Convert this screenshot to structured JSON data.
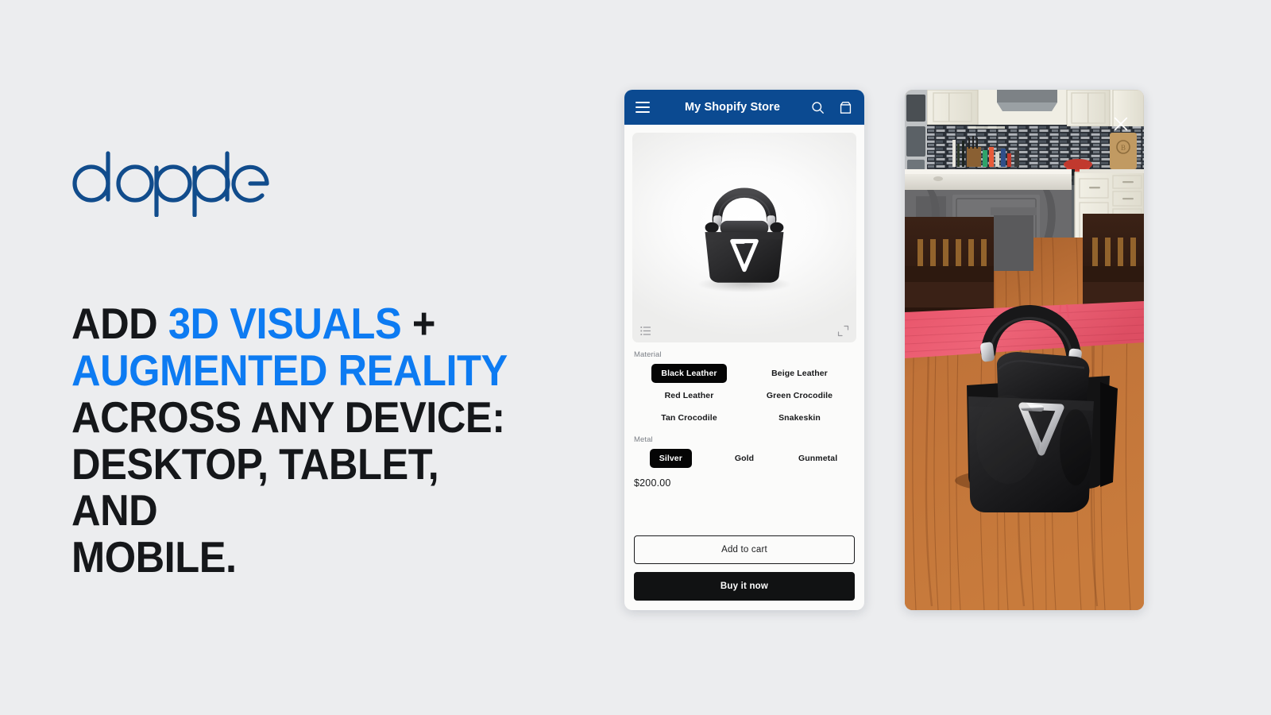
{
  "page": {
    "background_color": "#ECEDEF"
  },
  "brand": {
    "name": "dopple",
    "logo_color": "#114C8C"
  },
  "headline": {
    "line1_plain": "ADD ",
    "line1_accent": "3D VISUALS",
    "line1_tail": " +",
    "line2_accent": "AUGMENTED REALITY",
    "line3": "ACROSS ANY DEVICE:",
    "line4": "DESKTOP, TABLET, AND",
    "line5": "MOBILE.",
    "accent_color": "#0D7BF2",
    "text_color": "#15171A"
  },
  "phone": {
    "header": {
      "title": "My Shopify Store",
      "background_color": "#0B4A91",
      "menu_icon": "hamburger-icon",
      "search_icon": "search-icon",
      "cart_icon": "cart-icon"
    },
    "viewer": {
      "product_name": "black leather handbag",
      "list_icon": "variants-list-icon",
      "fullscreen_icon": "fullscreen-expand-icon"
    },
    "options": [
      {
        "label": "Material",
        "columns": 2,
        "values": [
          {
            "name": "Black Leather",
            "selected": true
          },
          {
            "name": "Beige Leather",
            "selected": false
          },
          {
            "name": "Red Leather",
            "selected": false
          },
          {
            "name": "Green Crocodile",
            "selected": false
          },
          {
            "name": "Tan Crocodile",
            "selected": false
          },
          {
            "name": "Snakeskin",
            "selected": false
          }
        ]
      },
      {
        "label": "Metal",
        "columns": 3,
        "values": [
          {
            "name": "Silver",
            "selected": true
          },
          {
            "name": "Gold",
            "selected": false
          },
          {
            "name": "Gunmetal",
            "selected": false
          }
        ]
      }
    ],
    "price": "$200.00",
    "buttons": {
      "add_to_cart": "Add to cart",
      "buy_it_now": "Buy it now"
    }
  },
  "ar": {
    "scene_description": "kitchen with hardwood floor and pink rug",
    "close_icon": "close-x-icon",
    "product_name": "black leather handbag"
  }
}
